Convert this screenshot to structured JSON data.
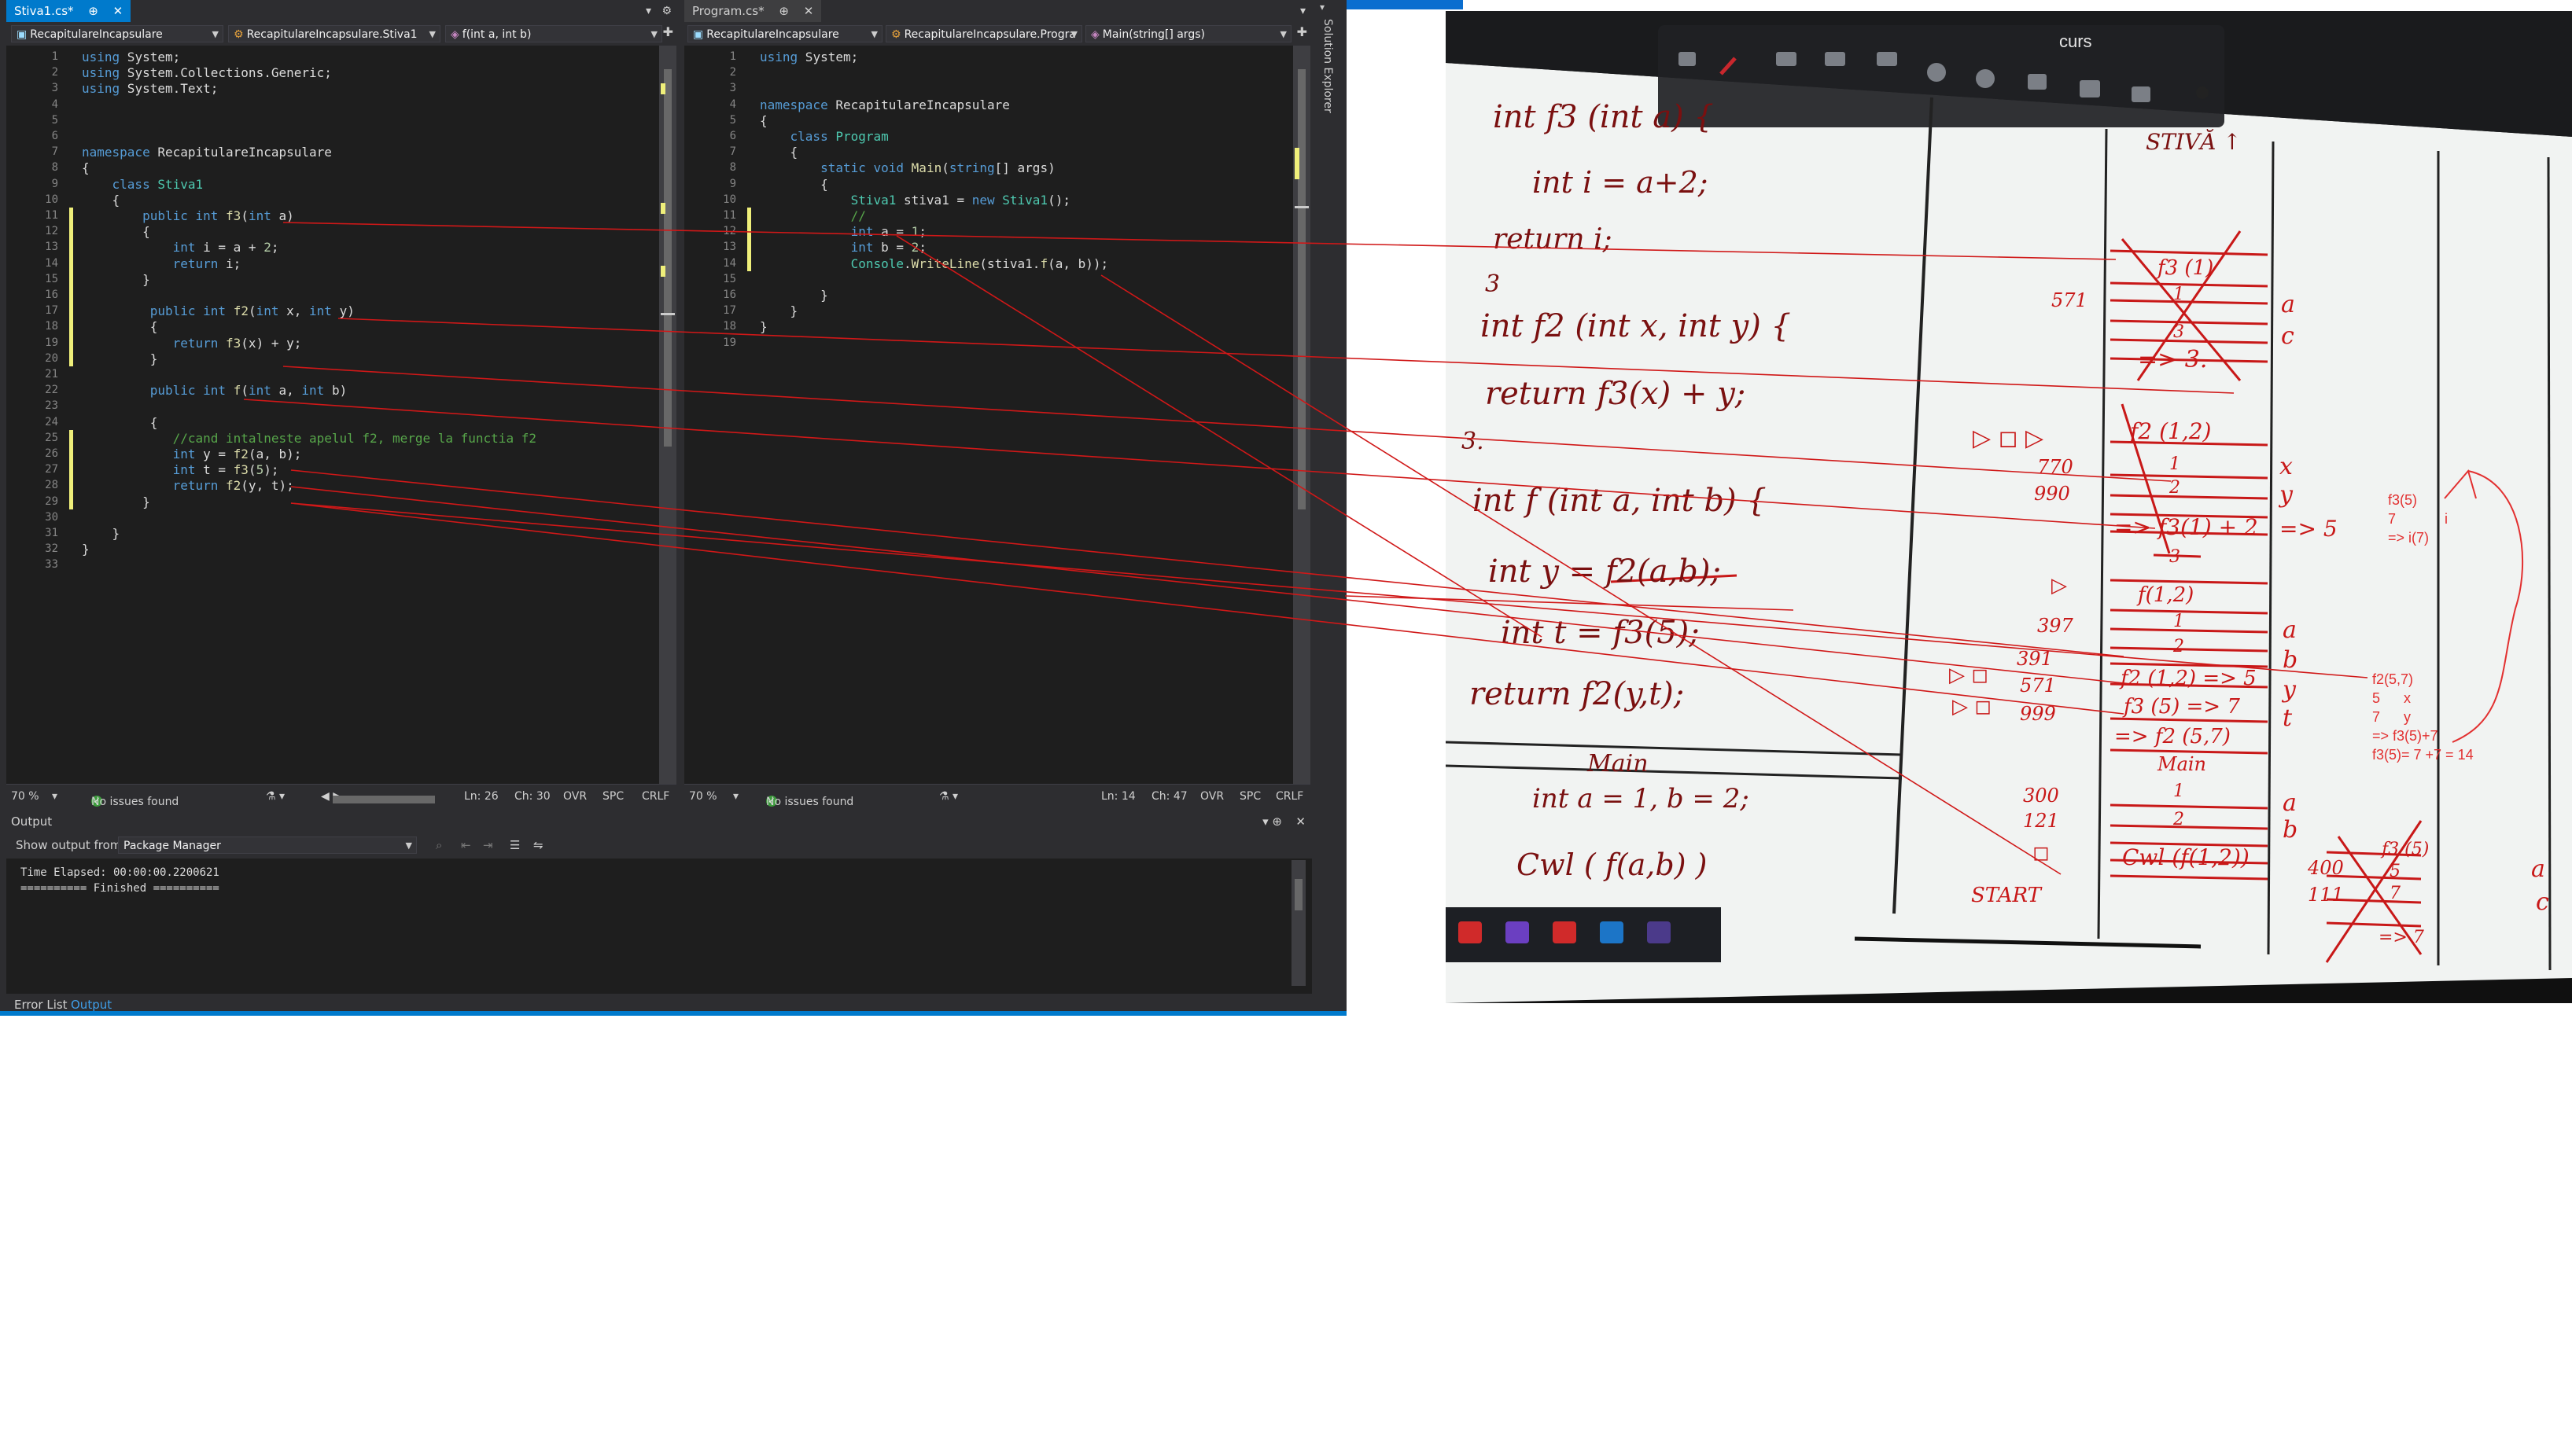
{
  "ide": {
    "left": {
      "tab_title": "Stiva1.cs*",
      "tab_pin": "⊕",
      "tab_close": "✕",
      "nav_project": "RecapitulareIncapsulare",
      "nav_class": "RecapitulareIncapsulare.Stiva1",
      "nav_member": "f(int a, int b)",
      "lines": [
        "1",
        "2",
        "3",
        "4",
        "5",
        "6",
        "7",
        "8",
        "9",
        "10",
        "11",
        "12",
        "13",
        "14",
        "15",
        "16",
        "17",
        "18",
        "19",
        "20",
        "21",
        "22",
        "23",
        "24",
        "25",
        "26",
        "27",
        "28",
        "29",
        "30",
        "31",
        "32",
        "33"
      ],
      "code": [
        "using System;",
        "using System.Collections.Generic;",
        "using System.Text;",
        "",
        "",
        "",
        "namespace RecapitulareIncapsulare",
        "{",
        "    class Stiva1",
        "    {",
        "        public int f3(int a)",
        "        {",
        "            int i = a + 2;",
        "            return i;",
        "        }",
        "",
        "         public int f2(int x, int y)",
        "         {",
        "            return f3(x) + y;",
        "         }",
        "",
        "         public int f(int a, int b)",
        "",
        "         {",
        "            //cand intalneste apelul f2, merge la functia f2",
        "            int y = f2(a, b);",
        "            int t = f3(5);",
        "            return f2(y, t);",
        "        }",
        "",
        "    }",
        "}",
        ""
      ],
      "zoom": "70 %",
      "issues": "No issues found",
      "ln": "Ln: 26",
      "ch": "Ch: 30",
      "ovr": "OVR",
      "spc": "SPC",
      "crlf": "CRLF"
    },
    "right": {
      "tab_title": "Program.cs*",
      "tab_pin": "⊕",
      "tab_close": "✕",
      "nav_project": "RecapitulareIncapsulare",
      "nav_class": "RecapitulareIncapsulare.Progra",
      "nav_member": "Main(string[] args)",
      "lines": [
        "1",
        "2",
        "3",
        "4",
        "5",
        "6",
        "7",
        "8",
        "9",
        "10",
        "11",
        "12",
        "13",
        "14",
        "15",
        "16",
        "17",
        "18",
        "19"
      ],
      "code": [
        "using System;",
        "",
        "",
        "namespace RecapitulareIncapsulare",
        "{",
        "    class Program",
        "    {",
        "        static void Main(string[] args)",
        "        {",
        "            Stiva1 stiva1 = new Stiva1();",
        "            //",
        "            int a = 1;",
        "            int b = 2;",
        "            Console.WriteLine(stiva1.f(a, b));",
        "",
        "        }",
        "    }",
        "}",
        ""
      ],
      "zoom": "70 %",
      "issues": "No issues found",
      "ln": "Ln: 14",
      "ch": "Ch: 47",
      "ovr": "OVR",
      "spc": "SPC",
      "crlf": "CRLF"
    },
    "solution_explorer": "Solution Explorer",
    "output": {
      "title": "Output",
      "show_from_label": "Show output from:",
      "show_from_value": "Package Manager",
      "text": "Time Elapsed: 00:00:00.2200621\n========== Finished ==========",
      "tab_error_list": "Error List",
      "tab_output": "Output"
    },
    "colors": {
      "accent": "#007acc",
      "keyword": "#569cd6",
      "type": "#4ec9b0",
      "comment": "#57a64a",
      "method": "#dcdcaa"
    }
  },
  "whiteboard": {
    "toolbar_title": "curs",
    "left_column": [
      "int f3 (int a) {",
      "int i = a+2;",
      "return i;",
      "3",
      "int f2 (int x, int y) {",
      "return f3(x) + y;",
      "3.",
      "int f (int a, int b) {",
      "int y = f2(a,b);",
      "int t = f3(5);",
      "return f2(y,t);",
      "Main",
      "int a = 1,  b = 2;",
      "Cwl ( f(a,b) )"
    ],
    "stack_title": "STIVĂ ↑",
    "stack_cells": [
      "f3 (1)",
      "1",
      "3",
      "=> 3.",
      "f2 (1,2)",
      "1",
      "2",
      "=> f3(1) + 2",
      "3",
      "f(1,2)",
      "1",
      "2",
      "f2 (1,2) => 5",
      "f3 (5) => 7",
      "=> f2 (5,7)",
      "Main",
      "1",
      "2",
      "Cwl (f(1,2))"
    ],
    "stack_addresses": [
      "571",
      "770",
      "990",
      "397",
      "391",
      "571",
      "999",
      "300",
      "121",
      "400",
      "111"
    ],
    "stack_labels": [
      "a",
      "c",
      "x",
      "y",
      "=> 5",
      "a",
      "b",
      "y",
      "t",
      "a",
      "b",
      "a",
      "c"
    ],
    "start_label": "START",
    "mini_stack": [
      "f3 (5)",
      "5",
      "7",
      "=> 7"
    ],
    "annotations_top": [
      "f3(5)",
      "7",
      "=> i(7)",
      "i"
    ],
    "annotations_bottom": [
      "f2(5,7)",
      "5      x",
      "7      y",
      "=> f3(5)+7",
      "f3(5)= 7 +7 = 14"
    ],
    "colors": {
      "board": "#f2f4f3",
      "ink": "#7a1010",
      "red_marker": "#c81818",
      "annotation": "#e23030"
    }
  }
}
